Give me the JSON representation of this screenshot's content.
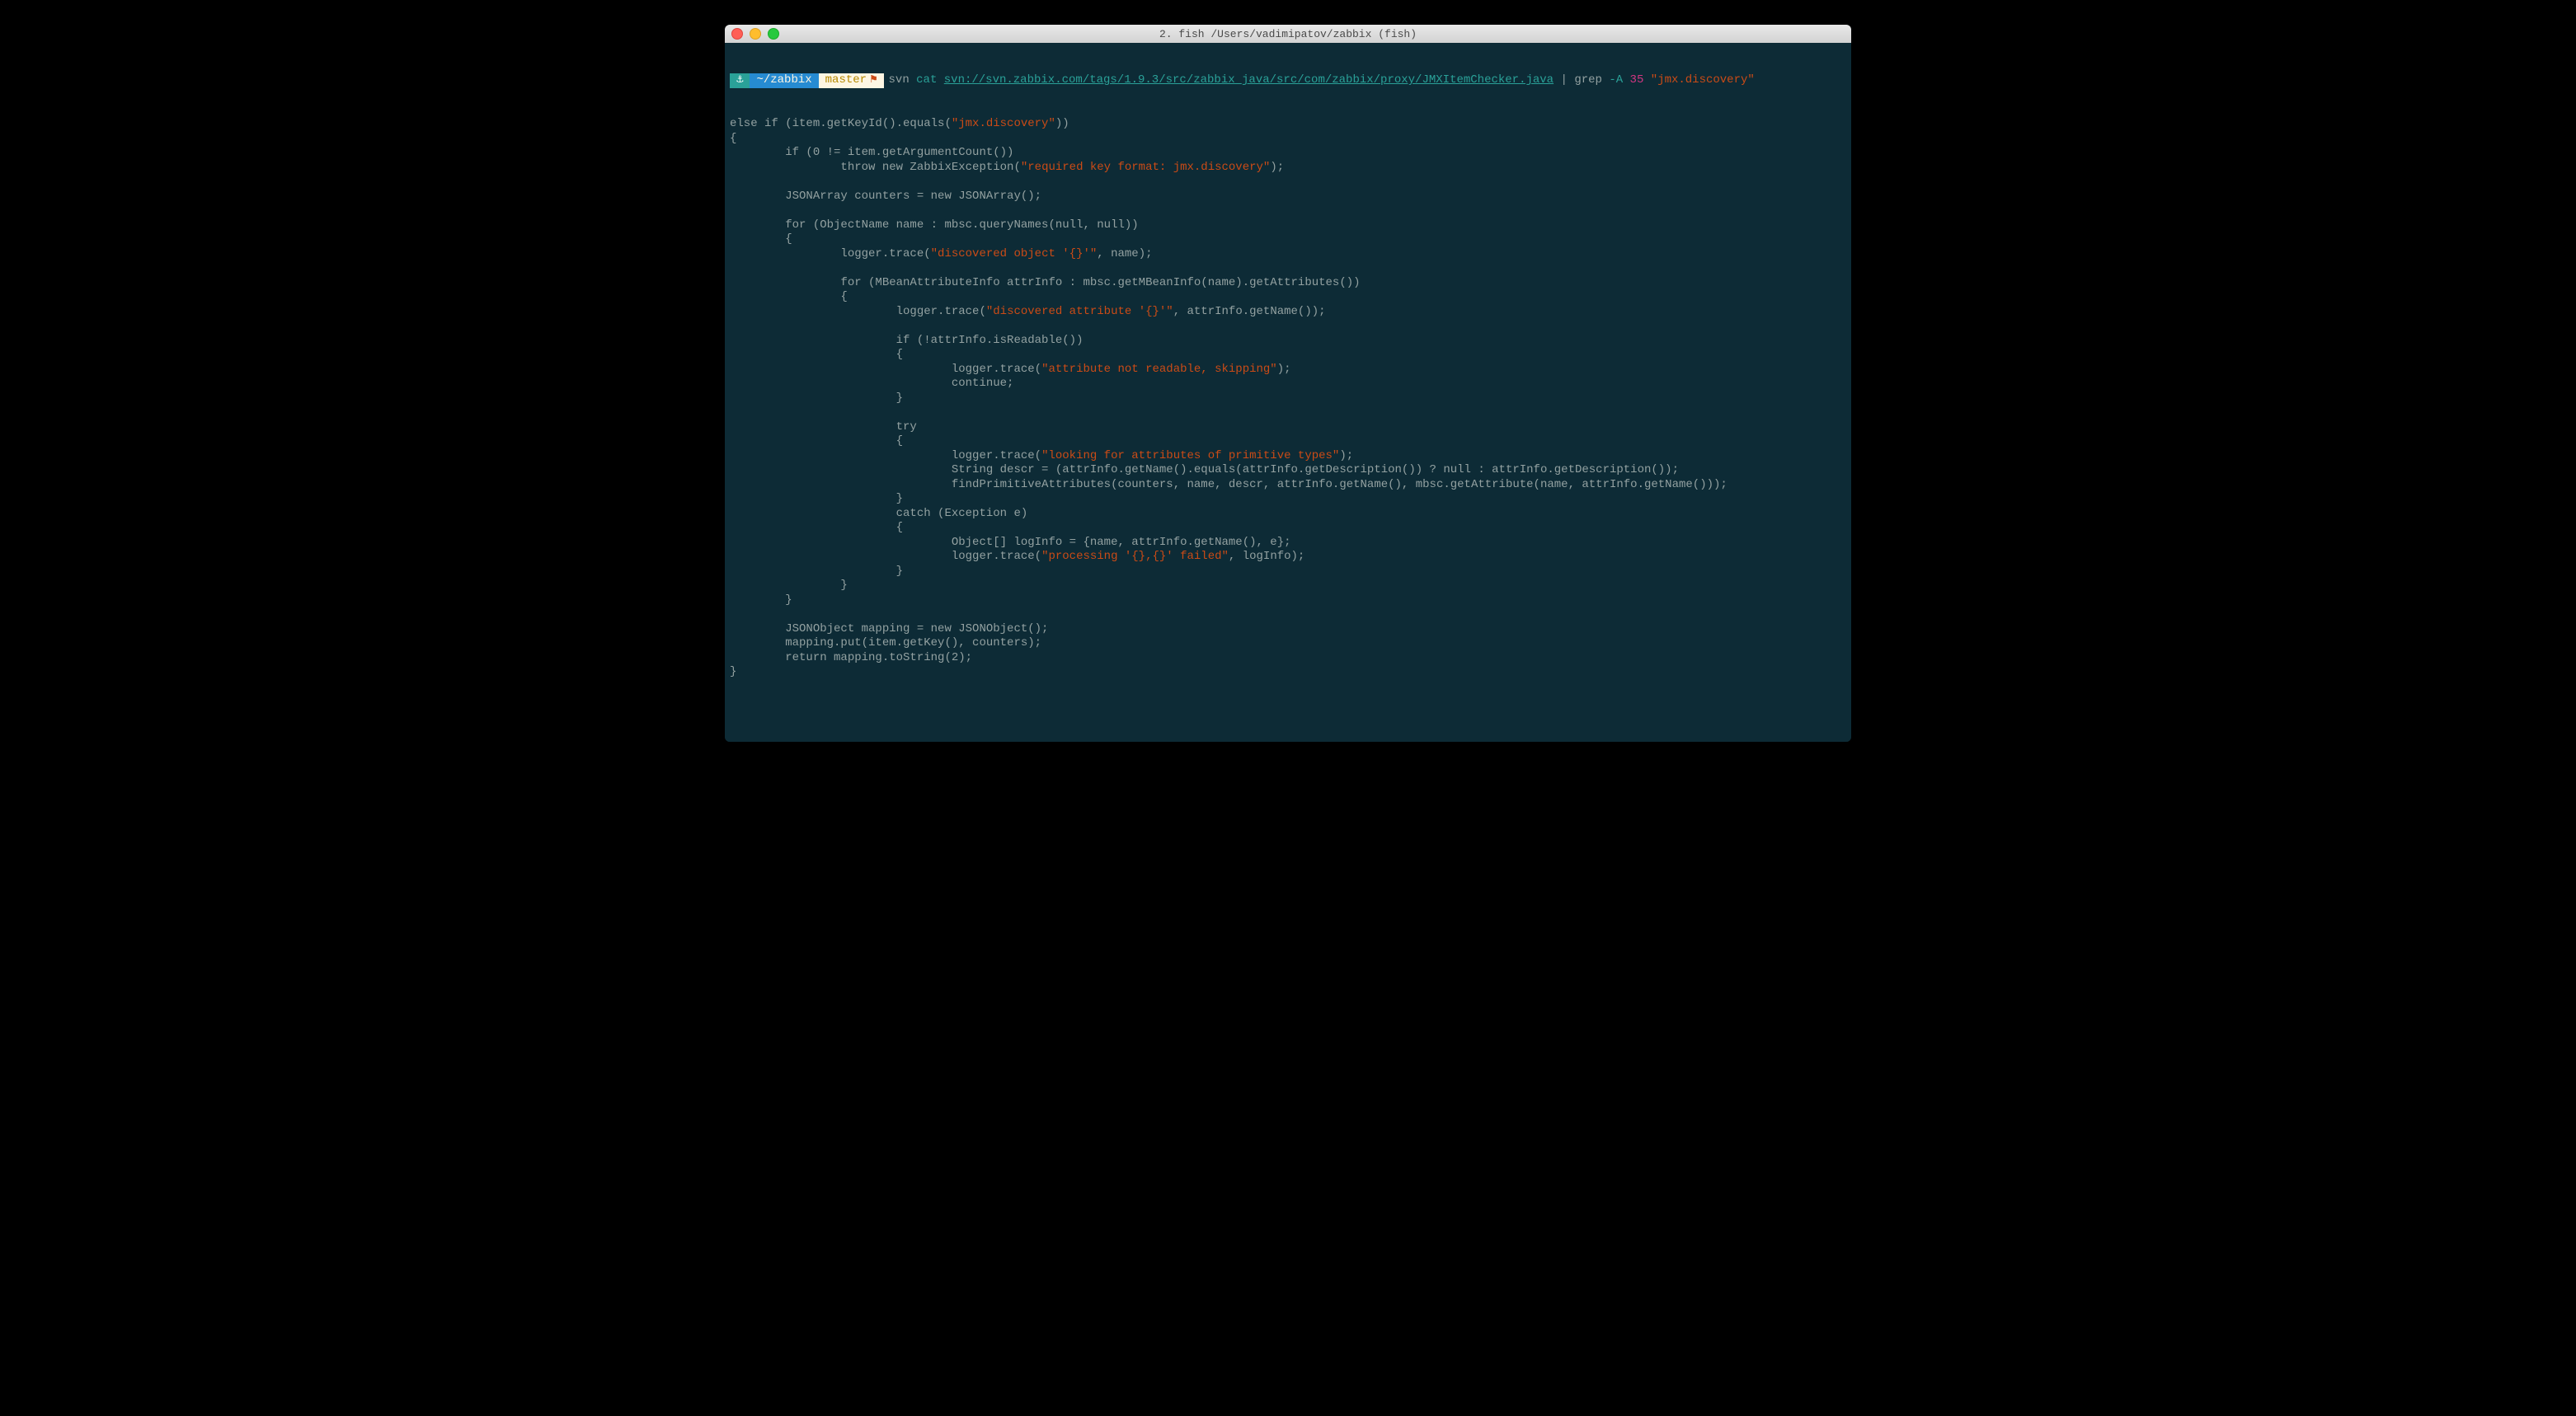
{
  "window": {
    "title": "2. fish  /Users/vadimipatov/zabbix (fish)"
  },
  "prompt": {
    "anchor": "⚓",
    "path": "~/zabbix",
    "branch": "master",
    "flag": "⚑"
  },
  "command": {
    "svn": "svn",
    "cat": "cat",
    "url": "svn://svn.zabbix.com/tags/1.9.3/src/zabbix_java/src/com/zabbix/proxy/JMXItemChecker.java",
    "pipe": "|",
    "grep": "grep",
    "opt": "-A",
    "num": "35",
    "pattern": "\"jmx.discovery\""
  },
  "output": "else if (item.getKeyId().equals(\"jmx.discovery\"))\n{\n        if (0 != item.getArgumentCount())\n                throw new ZabbixException(\"required key format: jmx.discovery\");\n\n        JSONArray counters = new JSONArray();\n\n        for (ObjectName name : mbsc.queryNames(null, null))\n        {\n                logger.trace(\"discovered object '{}'\", name);\n\n                for (MBeanAttributeInfo attrInfo : mbsc.getMBeanInfo(name).getAttributes())\n                {\n                        logger.trace(\"discovered attribute '{}'\", attrInfo.getName());\n\n                        if (!attrInfo.isReadable())\n                        {\n                                logger.trace(\"attribute not readable, skipping\");\n                                continue;\n                        }\n\n                        try\n                        {\n                                logger.trace(\"looking for attributes of primitive types\");\n                                String descr = (attrInfo.getName().equals(attrInfo.getDescription()) ? null : attrInfo.getDescription());\n                                findPrimitiveAttributes(counters, name, descr, attrInfo.getName(), mbsc.getAttribute(name, attrInfo.getName()));\n                        }\n                        catch (Exception e)\n                        {\n                                Object[] logInfo = {name, attrInfo.getName(), e};\n                                logger.trace(\"processing '{},{}' failed\", logInfo);\n                        }\n                }\n        }\n\n        JSONObject mapping = new JSONObject();\n        mapping.put(item.getKey(), counters);\n        return mapping.toString(2);\n}"
}
